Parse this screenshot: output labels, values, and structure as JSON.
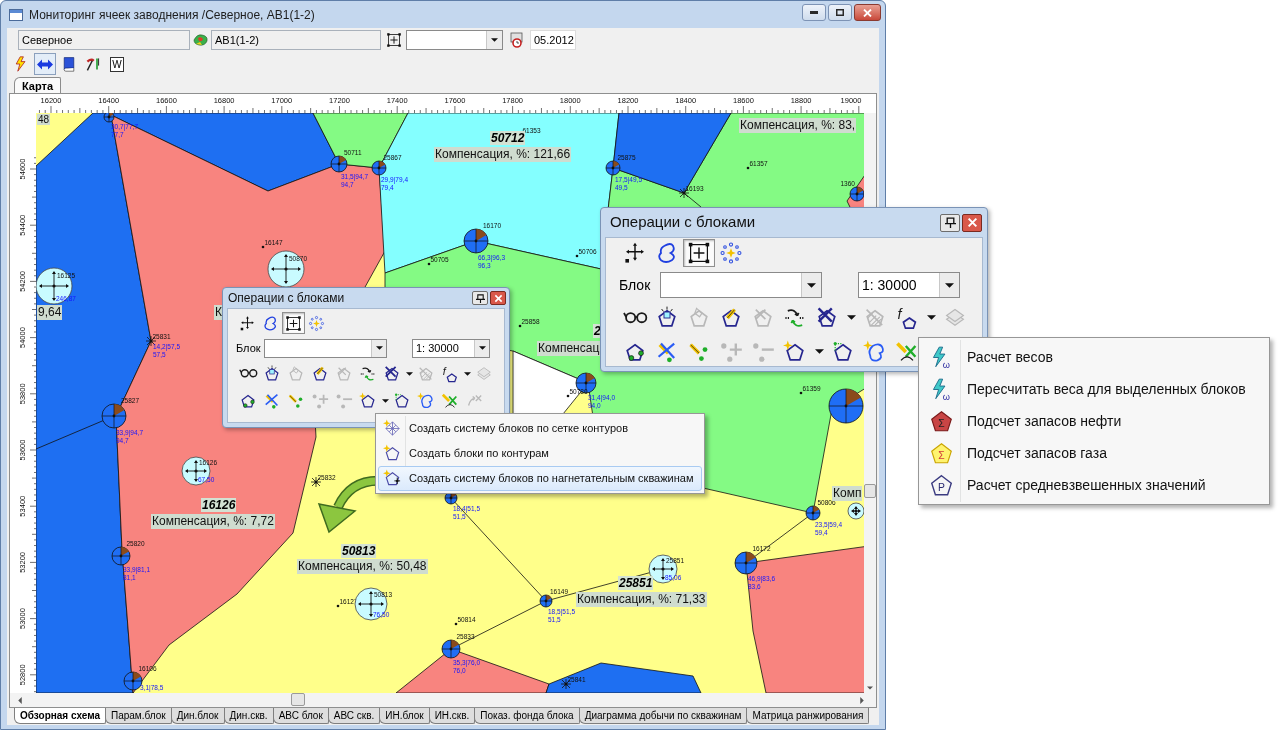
{
  "window": {
    "title": "Мониторинг ячеек заводнения /Северное, АВ1(1-2)"
  },
  "header": {
    "deposit": "Северное",
    "object": "АВ1(1-2)",
    "date": "05.2012"
  },
  "toolbar": [
    {
      "selected": false
    },
    {
      "selected": true
    },
    {
      "selected": false
    },
    {
      "selected": false
    },
    {
      "selected": false,
      "label": "W"
    }
  ],
  "view_tabs": [
    {
      "label": "Карта",
      "selected": true
    }
  ],
  "ruler": {
    "x_labels": [
      "16200",
      "16400",
      "16600",
      "16800",
      "17000",
      "17200",
      "17400",
      "17600",
      "17800",
      "18000",
      "18200",
      "18400",
      "18600",
      "18800",
      "19000"
    ],
    "y_labels": [
      "54600",
      "54400",
      "54200",
      "54000",
      "53800",
      "53600",
      "53400",
      "53200",
      "53000",
      "52800"
    ]
  },
  "map": {
    "block_labels": [
      {
        "number": "50712",
        "compensation": "Компенсация, %: 121,66"
      },
      {
        "compensation": "Компенсация, %: 83,"
      },
      {
        "compensation": "48"
      },
      {
        "compensation": "9,64"
      },
      {
        "compensation": "К"
      },
      {
        "number": "2",
        "compensation": "Компенсац"
      },
      {
        "number": "16126",
        "compensation": "Компенсация, %: 7,72"
      },
      {
        "compensation": "Комп"
      },
      {
        "number": "50813",
        "compensation": "Компенсация, %: 50,48"
      },
      {
        "number": "25851",
        "compensation": "Компенсация, %: 71,33"
      }
    ],
    "wells": [
      {
        "kind": "producer",
        "values": [
          "30,7|77,7",
          "77,7"
        ]
      },
      {
        "kind": "producer",
        "number": "50711",
        "values": [
          "31,5|94,7",
          "94,7"
        ]
      },
      {
        "kind": "producer",
        "number": "25867",
        "values": [
          "29,9|79,4",
          "79,4"
        ]
      },
      {
        "kind": "point",
        "number": "61353"
      },
      {
        "kind": "producer",
        "number": "25875",
        "values": [
          "17,5|49,5",
          "49,5"
        ]
      },
      {
        "kind": "point",
        "number": "61357"
      },
      {
        "kind": "star",
        "number": "16193"
      },
      {
        "kind": "producer",
        "number": "1360"
      },
      {
        "kind": "producer",
        "number": "16170",
        "values": [
          "66,3|96,3",
          "96,3"
        ]
      },
      {
        "kind": "point",
        "number": "50705"
      },
      {
        "kind": "point",
        "number": "50706"
      },
      {
        "kind": "point",
        "number": "16147"
      },
      {
        "kind": "injector",
        "number": "50870"
      },
      {
        "kind": "injector",
        "number": "16125",
        "values": [
          "246,87"
        ]
      },
      {
        "kind": "star",
        "number": "25831",
        "values": [
          "14,2|57,5",
          "57,5"
        ]
      },
      {
        "kind": "point",
        "number": "25858"
      },
      {
        "kind": "producer",
        "values": [
          "31,4|94,0",
          "94,0"
        ]
      },
      {
        "kind": "point",
        "number": "50780"
      },
      {
        "kind": "producer",
        "number": "25827",
        "values": [
          "33,9|94,7",
          "94,7"
        ]
      },
      {
        "kind": "producer"
      },
      {
        "kind": "point",
        "number": "61359"
      },
      {
        "kind": "injector",
        "number": "16126",
        "values": [
          "67,50"
        ]
      },
      {
        "kind": "star",
        "number": "25832"
      },
      {
        "kind": "producer",
        "values": [
          "18,4|51,5",
          "51,5"
        ]
      },
      {
        "kind": "producer",
        "number": "50806",
        "values": [
          "23,5|59,4",
          "59,4"
        ]
      },
      {
        "kind": "injector"
      },
      {
        "kind": "producer",
        "number": "25820",
        "values": [
          "33,9|81,1",
          "81,1"
        ]
      },
      {
        "kind": "injector",
        "number": "25851",
        "values": [
          "85,06"
        ]
      },
      {
        "kind": "producer",
        "number": "16172",
        "values": [
          "46,9|83,6",
          "83,6"
        ]
      },
      {
        "kind": "point",
        "number": "16127"
      },
      {
        "kind": "injector",
        "number": "50813",
        "values": [
          "76,50"
        ]
      },
      {
        "kind": "point",
        "number": "50814"
      },
      {
        "kind": "producer",
        "number": "16149",
        "values": [
          "18,5|51,5",
          "51,5"
        ]
      },
      {
        "kind": "producer",
        "number": "25833",
        "values": [
          "35,3|76,0",
          "76,0"
        ]
      },
      {
        "kind": "producer",
        "number": "16106",
        "values": [
          "3,1|78,5"
        ]
      },
      {
        "kind": "star",
        "number": "25841"
      }
    ]
  },
  "panels": [
    {
      "title": "Операции с блоками",
      "modes": [
        {
          "selected": false
        },
        {
          "selected": false
        },
        {
          "selected": true
        },
        {
          "selected": false
        }
      ],
      "block_label": "Блок",
      "scale": "1: 30000",
      "tools": [
        [
          {
            "disabled": false
          },
          {
            "disabled": false
          },
          {
            "disabled": true
          },
          {
            "disabled": false
          },
          {
            "disabled": true
          },
          {
            "disabled": false
          },
          {
            "disabled": false,
            "menu": true
          },
          {
            "disabled": true
          },
          {
            "disabled": false,
            "menu": true,
            "glyph": "f"
          },
          {
            "disabled": true
          }
        ],
        [
          {
            "disabled": false
          },
          {
            "disabled": false
          },
          {
            "disabled": false
          },
          {
            "disabled": true
          },
          {
            "disabled": true
          },
          {
            "disabled": false,
            "menu": true
          },
          {
            "disabled": false
          },
          {
            "disabled": false
          },
          {
            "disabled": false
          },
          {
            "disabled": true
          }
        ]
      ]
    },
    {
      "title": "Операции с блоками",
      "modes": [
        {
          "selected": false
        },
        {
          "selected": false
        },
        {
          "selected": true
        },
        {
          "selected": false
        }
      ],
      "block_label": "Блок",
      "scale": "1: 30000",
      "tools": [
        [
          {
            "disabled": false
          },
          {
            "disabled": false
          },
          {
            "disabled": true
          },
          {
            "disabled": false
          },
          {
            "disabled": true
          },
          {
            "disabled": false
          },
          {
            "disabled": false,
            "menu": true
          },
          {
            "disabled": true
          },
          {
            "disabled": false,
            "menu": true,
            "glyph": "f"
          },
          {
            "disabled": true
          }
        ],
        [
          {
            "disabled": false
          },
          {
            "disabled": false
          },
          {
            "disabled": false
          },
          {
            "disabled": true
          },
          {
            "disabled": true
          },
          {
            "disabled": false,
            "menu": true
          },
          {
            "disabled": false
          },
          {
            "disabled": false
          },
          {
            "disabled": false
          }
        ]
      ]
    }
  ],
  "menus": [
    {
      "items": [
        {
          "label": "Создать систему блоков по сетке контуров",
          "selected": false
        },
        {
          "label": "Создать блоки по контурам",
          "selected": false
        },
        {
          "label": "Создать систему блоков по нагнетательным скважинам",
          "selected": true
        }
      ]
    },
    {
      "items": [
        {
          "label": "Расчет весов",
          "selected": false,
          "glyph": "ω"
        },
        {
          "label": "Пересчитать веса для выделенных блоков",
          "selected": false,
          "glyph": "ω"
        },
        {
          "label": "Подсчет запасов нефти",
          "selected": false,
          "glyph": "Σ"
        },
        {
          "label": "Подсчет запасов газа",
          "selected": false,
          "glyph": "Σ"
        },
        {
          "label": "Расчет средневзвешенных значений",
          "selected": false,
          "glyph": "P"
        }
      ]
    }
  ],
  "bottom_tabs": [
    {
      "label": "Обзорная схема",
      "selected": true
    },
    {
      "label": "Парам.блок",
      "selected": false
    },
    {
      "label": "Дин.блок",
      "selected": false
    },
    {
      "label": "Дин.скв.",
      "selected": false
    },
    {
      "label": "АВС блок",
      "selected": false
    },
    {
      "label": "АВС скв.",
      "selected": false
    },
    {
      "label": "ИН.блок",
      "selected": false
    },
    {
      "label": "ИН.скв.",
      "selected": false
    },
    {
      "label": "Показ. фонда блока",
      "selected": false
    },
    {
      "label": "Диаграмма добычи по скважинам",
      "selected": false
    },
    {
      "label": "Матрица ранжирования",
      "selected": false
    }
  ]
}
